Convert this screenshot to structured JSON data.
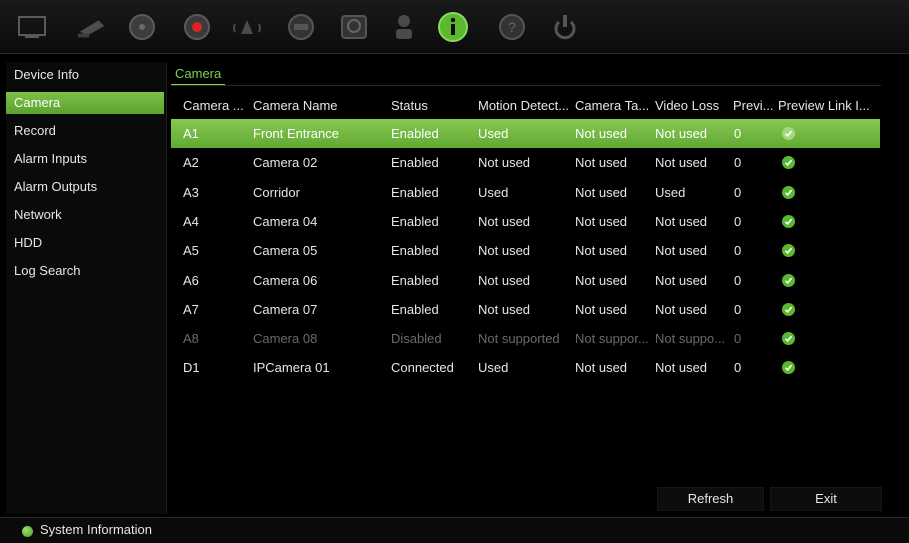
{
  "toolbar": {
    "icons": [
      "monitor-icon",
      "ptz-camera-icon",
      "playback-icon",
      "record-icon",
      "alarm-icon",
      "network-icon",
      "hdd-icon",
      "user-icon",
      "information-icon",
      "help-icon",
      "power-icon"
    ],
    "active_icon": "information-icon",
    "accent": "#5cb82f"
  },
  "sidebar": {
    "items": [
      {
        "label": "Device Info"
      },
      {
        "label": "Camera"
      },
      {
        "label": "Record"
      },
      {
        "label": "Alarm Inputs"
      },
      {
        "label": "Alarm Outputs"
      },
      {
        "label": "Network"
      },
      {
        "label": "HDD"
      },
      {
        "label": "Log Search"
      }
    ],
    "active_index": 1
  },
  "main": {
    "tab_label": "Camera",
    "columns": [
      "Camera ...",
      "Camera Name",
      "Status",
      "Motion Detect...",
      "Camera Ta...",
      "Video Loss",
      "Previ...",
      "Preview Link I..."
    ],
    "rows": [
      {
        "id": "A1",
        "name": "Front Entrance",
        "status": "Enabled",
        "motion": "Used",
        "tamper": "Not used",
        "video_loss": "Not used",
        "preview": "0",
        "link": "check",
        "selected": true
      },
      {
        "id": "A2",
        "name": "Camera 02",
        "status": "Enabled",
        "motion": "Not used",
        "tamper": "Not used",
        "video_loss": "Not used",
        "preview": "0",
        "link": "check"
      },
      {
        "id": "A3",
        "name": "Corridor",
        "status": "Enabled",
        "motion": "Used",
        "tamper": "Not used",
        "video_loss": "Used",
        "preview": "0",
        "link": "check"
      },
      {
        "id": "A4",
        "name": "Camera 04",
        "status": "Enabled",
        "motion": "Not used",
        "tamper": "Not used",
        "video_loss": "Not used",
        "preview": "0",
        "link": "check"
      },
      {
        "id": "A5",
        "name": "Camera 05",
        "status": "Enabled",
        "motion": "Not used",
        "tamper": "Not used",
        "video_loss": "Not used",
        "preview": "0",
        "link": "check"
      },
      {
        "id": "A6",
        "name": "Camera 06",
        "status": "Enabled",
        "motion": "Not used",
        "tamper": "Not used",
        "video_loss": "Not used",
        "preview": "0",
        "link": "check"
      },
      {
        "id": "A7",
        "name": "Camera 07",
        "status": "Enabled",
        "motion": "Not used",
        "tamper": "Not used",
        "video_loss": "Not used",
        "preview": "0",
        "link": "check"
      },
      {
        "id": "A8",
        "name": "Camera 08",
        "status": "Disabled",
        "motion": "Not supported",
        "tamper": "Not suppor...",
        "video_loss": "Not suppo...",
        "preview": "0",
        "link": "check",
        "disabled": true
      },
      {
        "id": "D1",
        "name": "IPCamera 01",
        "status": "Connected",
        "motion": "Used",
        "tamper": "Not used",
        "video_loss": "Not used",
        "preview": "0",
        "link": "check"
      }
    ]
  },
  "buttons": {
    "refresh": "Refresh",
    "exit": "Exit"
  },
  "statusbar": {
    "text": "System Information"
  }
}
